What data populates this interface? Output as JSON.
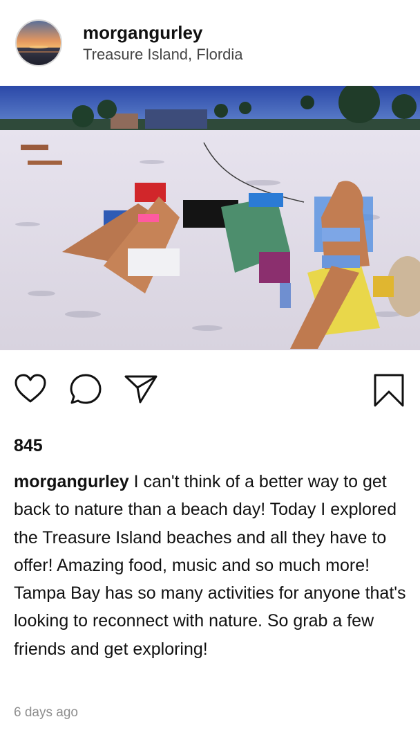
{
  "post": {
    "username": "morgangurley",
    "location": "Treasure Island, Flordia",
    "likes": "845",
    "caption_user": "morgangurley",
    "caption_text": "I can't think of a better way to get back to nature than a beach day! Today I explored the Treasure Island beaches and all they have to offer! Amazing food, music and so much more! Tampa Bay has so many activities for anyone that's looking to reconnect with nature. So grab a few friends and get exploring!",
    "time_ago": "6 days ago"
  },
  "icons": {
    "like": "heart-icon",
    "comment": "comment-icon",
    "share": "paper-plane-icon",
    "save": "bookmark-icon"
  }
}
